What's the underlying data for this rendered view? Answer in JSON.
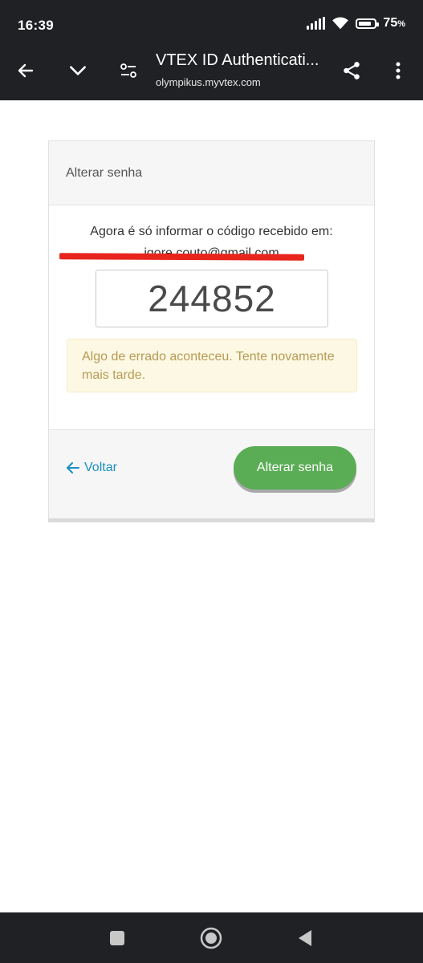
{
  "statusbar": {
    "time": "16:39",
    "battery_pct": "75",
    "battery_unit": "%"
  },
  "toolbar": {
    "title": "VTEX ID Authenticati...",
    "url": "olympikus.myvtex.com"
  },
  "card": {
    "header": "Alterar senha",
    "instruction": "Agora é só informar o código recebido em:",
    "email_redacted": "igore.couto@gmail.com",
    "code_value": "244852",
    "alert": "Algo de errado aconteceu. Tente novamente mais tarde.",
    "back_label": "Voltar",
    "submit_label": "Alterar senha"
  },
  "colors": {
    "chrome": "#202124",
    "accent_green": "#5aac55",
    "link_blue": "#1a8fc2",
    "alert_bg": "#fcf8e3",
    "alert_text": "#b89a55",
    "redaction": "#e8251c"
  },
  "icons": {
    "back": "arrow-left-icon",
    "collapse": "chevron-down-icon",
    "site_settings": "tune-icon",
    "share": "share-icon",
    "menu": "more-vert-icon",
    "nav_recents": "square-icon",
    "nav_home": "circle-icon",
    "nav_back": "triangle-back-icon"
  }
}
